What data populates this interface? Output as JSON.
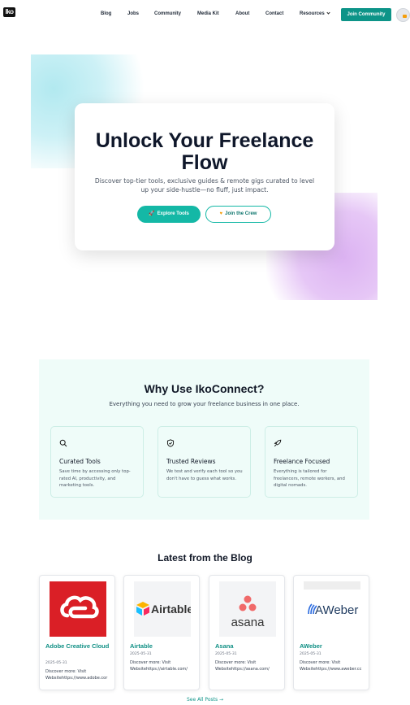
{
  "nav": {
    "logo": "Iko",
    "links": [
      "Blog",
      "Jobs",
      "Community",
      "Media Kit",
      "About",
      "Contact",
      "Resources"
    ],
    "join_label": "Join Community"
  },
  "hero": {
    "title": "Unlock Your Freelance Flow",
    "subtitle": "Discover top-tier tools, exclusive guides & remote gigs curated to level up your side-hustle—no fluff, just impact.",
    "explore_label": "Explore Tools",
    "crew_label": "Join the Crew",
    "accent": "#14b8a6"
  },
  "why": {
    "title": "Why Use IkoConnect?",
    "subtitle": "Everything you need to grow your freelance business in one place.",
    "features": [
      {
        "icon": "search-icon",
        "title": "Curated Tools",
        "desc": "Save time by accessing only top-rated AI, productivity, and marketing tools."
      },
      {
        "icon": "shield-check-icon",
        "title": "Trusted Reviews",
        "desc": "We test and verify each tool so you don't have to guess what works."
      },
      {
        "icon": "rocket-icon",
        "title": "Freelance Focused",
        "desc": "Everything is tailored for freelancers, remote workers, and digital nomads."
      }
    ]
  },
  "blog": {
    "title": "Latest from the Blog",
    "posts": [
      {
        "title": "Adobe Creative Cloud",
        "date": "2025-05-31",
        "desc1": "Discover more: Visit",
        "desc2": "Websitehttps://www.adobe.cor",
        "logo": "Adobe"
      },
      {
        "title": "Airtable",
        "date": "2025-05-31",
        "desc1": "Discover more: Visit",
        "desc2": "Websitehttps://airtable.com/",
        "logo": "Airtable"
      },
      {
        "title": "Asana",
        "date": "2025-05-31",
        "desc1": "Discover more: Visit",
        "desc2": "Websitehttps://asana.com/",
        "logo": "asana"
      },
      {
        "title": "AWeber",
        "date": "2025-05-31",
        "desc1": "Discover more: Visit",
        "desc2": "Websitehttps://www.aweber.cc",
        "logo": "AWeber"
      }
    ],
    "see_all": "See All Posts →"
  }
}
